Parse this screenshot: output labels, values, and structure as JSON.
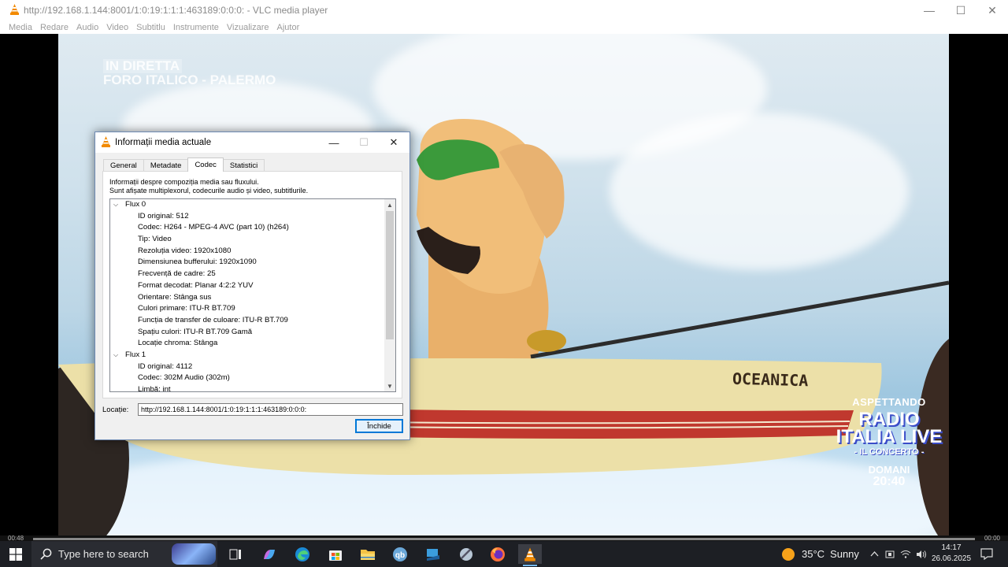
{
  "window": {
    "title": "http://192.168.1.144:8001/1:0:19:1:1:1:463189:0:0:0: - VLC media player",
    "minimize": "—",
    "maximize": "☐",
    "close": "✕"
  },
  "menu": [
    "Media",
    "Redare",
    "Audio",
    "Video",
    "Subtitlu",
    "Instrumente",
    "Vizualizare",
    "Ajutor"
  ],
  "video": {
    "osd_top_line1": "IN DIRETTA",
    "osd_top_line2": "FORO ITALICO - PALERMO",
    "promo_line1": "ASPETTANDO",
    "promo_line2": "RADIO ITALIA LIVE",
    "promo_line3": "- IL CONCERTO -",
    "promo_line4": "DOMANI",
    "promo_line5": "20:40",
    "boat_name": "OCEANICA"
  },
  "seekbar": {
    "time_elapsed": "00:48",
    "time_total": "00:00"
  },
  "dialog": {
    "title": "Informații media actuale",
    "tabs": [
      "General",
      "Metadate",
      "Codec",
      "Statistici"
    ],
    "active_tab": "Codec",
    "description_line1": "Informații despre compoziția media sau fluxului.",
    "description_line2": "Sunt afișate multiplexorul, codecurile audio și video, subtitlurile.",
    "tree": [
      {
        "type": "parent",
        "text": "Flux 0"
      },
      {
        "type": "child",
        "text": "ID original: 512"
      },
      {
        "type": "child",
        "text": "Codec: H264 - MPEG-4 AVC (part 10) (h264)"
      },
      {
        "type": "child",
        "text": "Tip: Video"
      },
      {
        "type": "child",
        "text": "Rezoluția video: 1920x1080"
      },
      {
        "type": "child",
        "text": "Dimensiunea bufferului: 1920x1090"
      },
      {
        "type": "child",
        "text": "Frecvență de cadre: 25"
      },
      {
        "type": "child",
        "text": "Format decodat: Planar 4:2:2 YUV"
      },
      {
        "type": "child",
        "text": "Orientare: Stânga sus"
      },
      {
        "type": "child",
        "text": "Culori primare: ITU-R BT.709"
      },
      {
        "type": "child",
        "text": "Funcția de transfer de culoare: ITU-R BT.709"
      },
      {
        "type": "child",
        "text": "Spațiu culori: ITU-R BT.709 Gamă"
      },
      {
        "type": "child",
        "text": "Locație chroma: Stânga"
      },
      {
        "type": "parent",
        "text": "Flux 1"
      },
      {
        "type": "child",
        "text": "ID original: 4112"
      },
      {
        "type": "child",
        "text": "Codec: 302M Audio (302m)"
      },
      {
        "type": "child",
        "text": "Limbă: int"
      }
    ],
    "location_label": "Locație:",
    "location_value": "http://192.168.1.144:8001/1:0:19:1:1:1:463189:0:0:0:",
    "close_button": "Închide"
  },
  "taskbar": {
    "search_placeholder": "Type here to search",
    "weather_temp": "35°C",
    "weather_desc": "Sunny",
    "time": "14:17",
    "date": "26.06.2025"
  },
  "colors": {
    "vlc_orange": "#f28a00",
    "accent_blue": "#0078d7",
    "taskbar_bg": "#1d1f24"
  }
}
